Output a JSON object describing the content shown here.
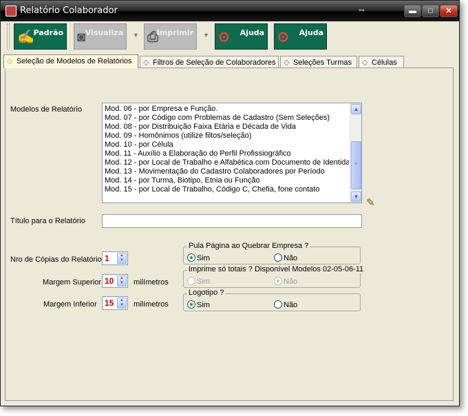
{
  "window": {
    "title": "Relatório Colaborador",
    "controls": {
      "minimize": "▬",
      "maximize": "□",
      "close": "✕"
    }
  },
  "toolbar": {
    "buttons": [
      {
        "label": "Padrão",
        "icon": "pen-icon",
        "enabled": true
      },
      {
        "label": "Visualiza",
        "icon": "camera-icon",
        "enabled": false
      },
      {
        "label": "Imprimir",
        "icon": "printer-icon",
        "enabled": false
      },
      {
        "label": "Ajuda",
        "icon": "magnifier-help-icon",
        "enabled": true
      },
      {
        "label": "Ajuda",
        "icon": "magnifier-help-icon",
        "enabled": true
      }
    ]
  },
  "tabs": [
    {
      "label": "Seleção de Modelos de Relatórios",
      "active": true
    },
    {
      "label": "Filtros de Seleção de Colaboradores",
      "active": false
    },
    {
      "label": "Seleções Turmas",
      "active": false
    },
    {
      "label": "Células",
      "active": false
    }
  ],
  "form": {
    "models_label": "Modelos de Relatório",
    "models": [
      "Mod. 06 - por Empresa e Função.",
      "Mod. 07 - por Código com Problemas de Cadastro (Sem Seleções)",
      "Mod. 08 - por Distribuição Faixa Etária e Década de Vida",
      "Mod. 09 - Homônimos (utilize filtos/seleção)",
      "Mod. 10 - por Célula",
      "Mod. 11 - Auxílio a Elaboração do Perfil Profissiográfico",
      "Mod. 12 - por Local de Trabalho e Alfabética com Documento de Identidade",
      "Mod. 13 - Movimentação do Cadastro Colaboradores por Período",
      "Mod. 14 - por Turma, Biotipo,  Etnia ou Função",
      "Mod. 15 - por Local de Trabalho, Código C, Chefia, fone contato"
    ],
    "title_label": "Título para o Relatório",
    "title_value": "",
    "copies_label": "Nro de Cópias do Relatório",
    "copies_value": "1",
    "top_margin_label": "Margem Superior",
    "top_margin_value": "10",
    "bottom_margin_label": "Margem Inferior",
    "bottom_margin_value": "15",
    "unit_label": "milímetros"
  },
  "groups": {
    "page_break": {
      "title": "Pula Página ao Quebrar Empresa ?",
      "yes": "Sim",
      "no": "Não",
      "selected": "yes"
    },
    "totals_only": {
      "title": "Imprime só totais ? Disponível  Modelos 02-05-06-11",
      "yes": "Sim",
      "no": "Não",
      "selected": "no"
    },
    "logo": {
      "title": "Logotipo ?",
      "yes": "Sim",
      "no": "Não",
      "selected": "yes"
    }
  }
}
